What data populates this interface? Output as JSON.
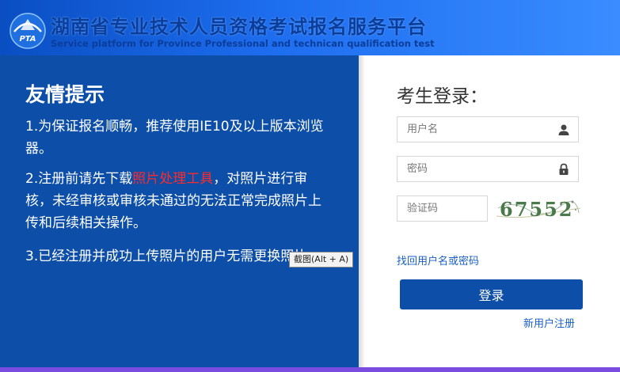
{
  "header": {
    "title": "湖南省专业技术人员资格考试报名服务平台",
    "subtitle": "Service platform for Province Professional and technican qualification test",
    "logo_text": "PTA"
  },
  "notice": {
    "title": "友情提示",
    "item1": "1.为保证报名顺畅，推荐使用IE10及以上版本浏览器。",
    "item2_before": "2.注册前请先下载",
    "item2_link": "照片处理工具",
    "item2_after": "，对照片进行审核，未经审核或审核未通过的无法正常完成照片上传和后续相关操作。",
    "item3": "3.已经注册并成功上传照片的用户无需更换照片。"
  },
  "tooltip": "截图(Alt + A)",
  "login": {
    "title": "考生登录：",
    "username_placeholder": "用户名",
    "password_placeholder": "密码",
    "captcha_placeholder": "验证码",
    "captcha_text": "67552",
    "forgot_label": "找回用户名或密码",
    "login_label": "登录",
    "register_label": "新用户注册"
  },
  "icons": {
    "username": "user-icon",
    "password": "lock-icon"
  },
  "colors": {
    "brand_blue": "#0c4ea8",
    "link_blue": "#1a5fc7",
    "highlight_red": "#ff2a2a"
  }
}
